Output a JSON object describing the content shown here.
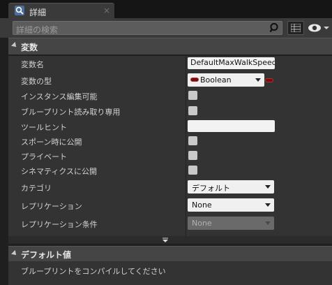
{
  "tab": {
    "title": "詳細",
    "close": "×",
    "icon": "details-magnifier-icon"
  },
  "toolbar": {
    "search_placeholder": "詳細の検索",
    "search_icon": "search-icon",
    "grid_icon": "property-matrix-icon",
    "eye_icon": "view-options-eye-icon"
  },
  "variables": {
    "title": "変数",
    "rows": [
      {
        "label": "変数名",
        "value": "DefaultMaxWalkSpeed"
      },
      {
        "label": "変数の型",
        "value": "Boolean"
      },
      {
        "label": "インスタンス編集可能"
      },
      {
        "label": "ブループリント読み取り専用"
      },
      {
        "label": "ツールヒント",
        "value": ""
      },
      {
        "label": "スポーン時に公開"
      },
      {
        "label": "プライベート"
      },
      {
        "label": "シネマティクスに公開"
      },
      {
        "label": "カテゴリ",
        "value": "デフォルト"
      },
      {
        "label": "レプリケーション",
        "value": "None"
      },
      {
        "label": "レプリケーション条件",
        "value": "None"
      }
    ]
  },
  "default_value": {
    "title": "デフォルト値",
    "message": "ブループリントをコンパイルしてください"
  },
  "colors": {
    "boolean_pin": "#7a0d0d",
    "panel_bg": "#333333",
    "header_bg": "#454545"
  }
}
